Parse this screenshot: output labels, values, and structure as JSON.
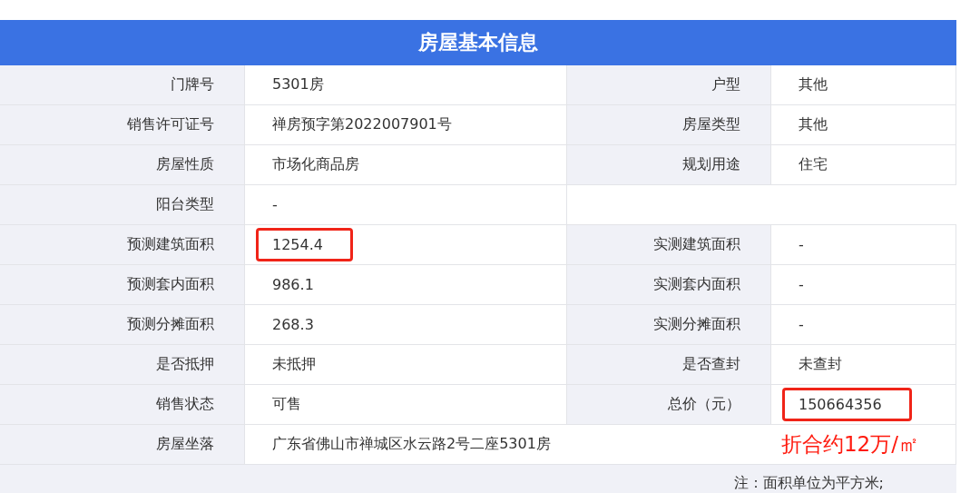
{
  "title": "房屋基本信息",
  "rows": [
    {
      "cells": [
        {
          "label": "门牌号",
          "value": "5301房"
        },
        {
          "label": "户型",
          "value": "其他"
        }
      ]
    },
    {
      "cells": [
        {
          "label": "销售许可证号",
          "value": "禅房预字第2022007901号"
        },
        {
          "label": "房屋类型",
          "value": "其他"
        }
      ]
    },
    {
      "cells": [
        {
          "label": "房屋性质",
          "value": "市场化商品房"
        },
        {
          "label": "规划用途",
          "value": "住宅"
        }
      ]
    },
    {
      "cells": [
        {
          "label": "阳台类型",
          "value": "-"
        }
      ]
    },
    {
      "cells": [
        {
          "label": "预测建筑面积",
          "value": "1254.4",
          "highlighted": true
        },
        {
          "label": "实测建筑面积",
          "value": "-"
        }
      ]
    },
    {
      "cells": [
        {
          "label": "预测套内面积",
          "value": "986.1"
        },
        {
          "label": "实测套内面积",
          "value": "-"
        }
      ]
    },
    {
      "cells": [
        {
          "label": "预测分摊面积",
          "value": "268.3"
        },
        {
          "label": "实测分摊面积",
          "value": "-"
        }
      ]
    },
    {
      "cells": [
        {
          "label": "是否抵押",
          "value": "未抵押"
        },
        {
          "label": "是否查封",
          "value": "未查封"
        }
      ]
    },
    {
      "cells": [
        {
          "label": "销售状态",
          "value": "可售"
        },
        {
          "label": "总价（元）",
          "value": "150664356",
          "highlighted": true
        }
      ]
    },
    {
      "cells": [
        {
          "label": "房屋坐落",
          "value": "广东省佛山市禅城区水云路2号二座5301房"
        }
      ],
      "annotation": "折合约12万/㎡"
    }
  ],
  "note": "注：面积单位为平方米;"
}
